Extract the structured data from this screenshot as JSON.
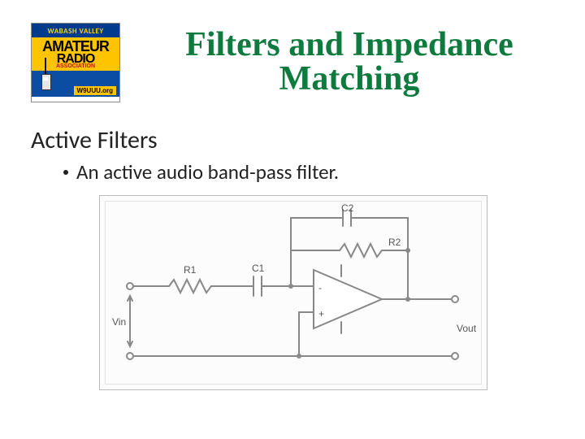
{
  "logo": {
    "top": "WABASH VALLEY",
    "line1": "AMATEUR",
    "line2": "RADIO",
    "assoc": "ASSOCIATION",
    "url": "W9UUU.org"
  },
  "title_line1": "Filters and Impedance",
  "title_line2": "Matching",
  "subtitle": "Active Filters",
  "bullet": "An active audio band-pass filter.",
  "circuit": {
    "vin": "Vin",
    "vout": "Vout",
    "r1": "R1",
    "r2": "R2",
    "c1": "C1",
    "c2": "C2",
    "plus": "+",
    "minus": "-"
  }
}
